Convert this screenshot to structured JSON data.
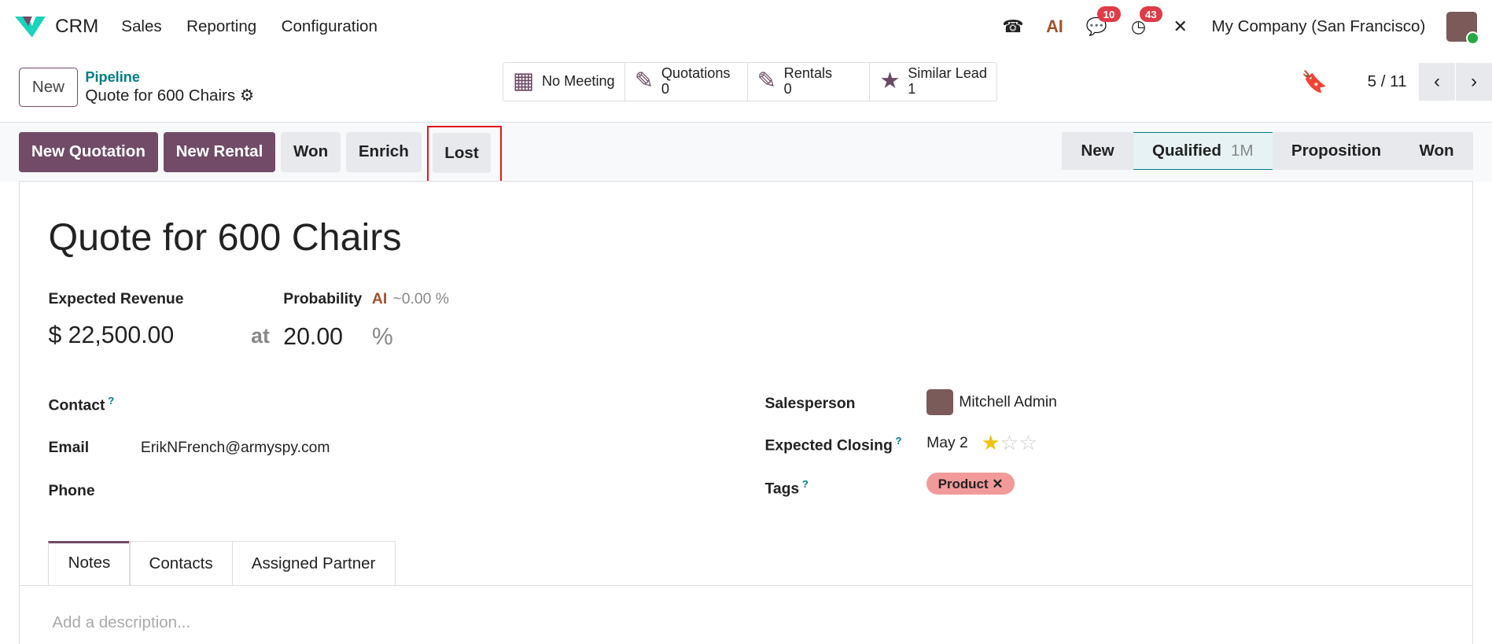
{
  "nav": {
    "app": "CRM",
    "menus": [
      "Sales",
      "Reporting",
      "Configuration"
    ],
    "chat_count": "10",
    "activity_count": "43",
    "company": "My Company (San Francisco)"
  },
  "control": {
    "new_label": "New",
    "breadcrumb_parent": "Pipeline",
    "breadcrumb_current": "Quote for 600 Chairs",
    "smart_buttons": [
      {
        "label": "No Meeting",
        "value": ""
      },
      {
        "label": "Quotations",
        "value": "0"
      },
      {
        "label": "Rentals",
        "value": "0"
      },
      {
        "label": "Similar Lead",
        "value": "1"
      }
    ],
    "pager": "5 / 11"
  },
  "actions": {
    "new_quotation": "New Quotation",
    "new_rental": "New Rental",
    "won": "Won",
    "enrich": "Enrich",
    "lost": "Lost"
  },
  "stages": [
    {
      "label": "New"
    },
    {
      "label": "Qualified",
      "sub": "1M",
      "active": true
    },
    {
      "label": "Proposition"
    },
    {
      "label": "Won"
    }
  ],
  "form": {
    "title": "Quote for 600 Chairs",
    "expected_revenue_label": "Expected Revenue",
    "expected_revenue": "$ 22,500.00",
    "at": "at",
    "probability_label": "Probability",
    "ai_probability": "~0.00 %",
    "probability": "20.00",
    "percent": "%",
    "contact_label": "Contact",
    "email_label": "Email",
    "email": "ErikNFrench@armyspy.com",
    "phone_label": "Phone",
    "salesperson_label": "Salesperson",
    "salesperson": "Mitchell Admin",
    "expected_closing_label": "Expected Closing",
    "expected_closing": "May 2",
    "priority_stars": 1,
    "tags_label": "Tags",
    "tags": [
      "Product"
    ],
    "q": "?"
  },
  "tabs": [
    "Notes",
    "Contacts",
    "Assigned Partner"
  ],
  "notes_placeholder": "Add a description..."
}
